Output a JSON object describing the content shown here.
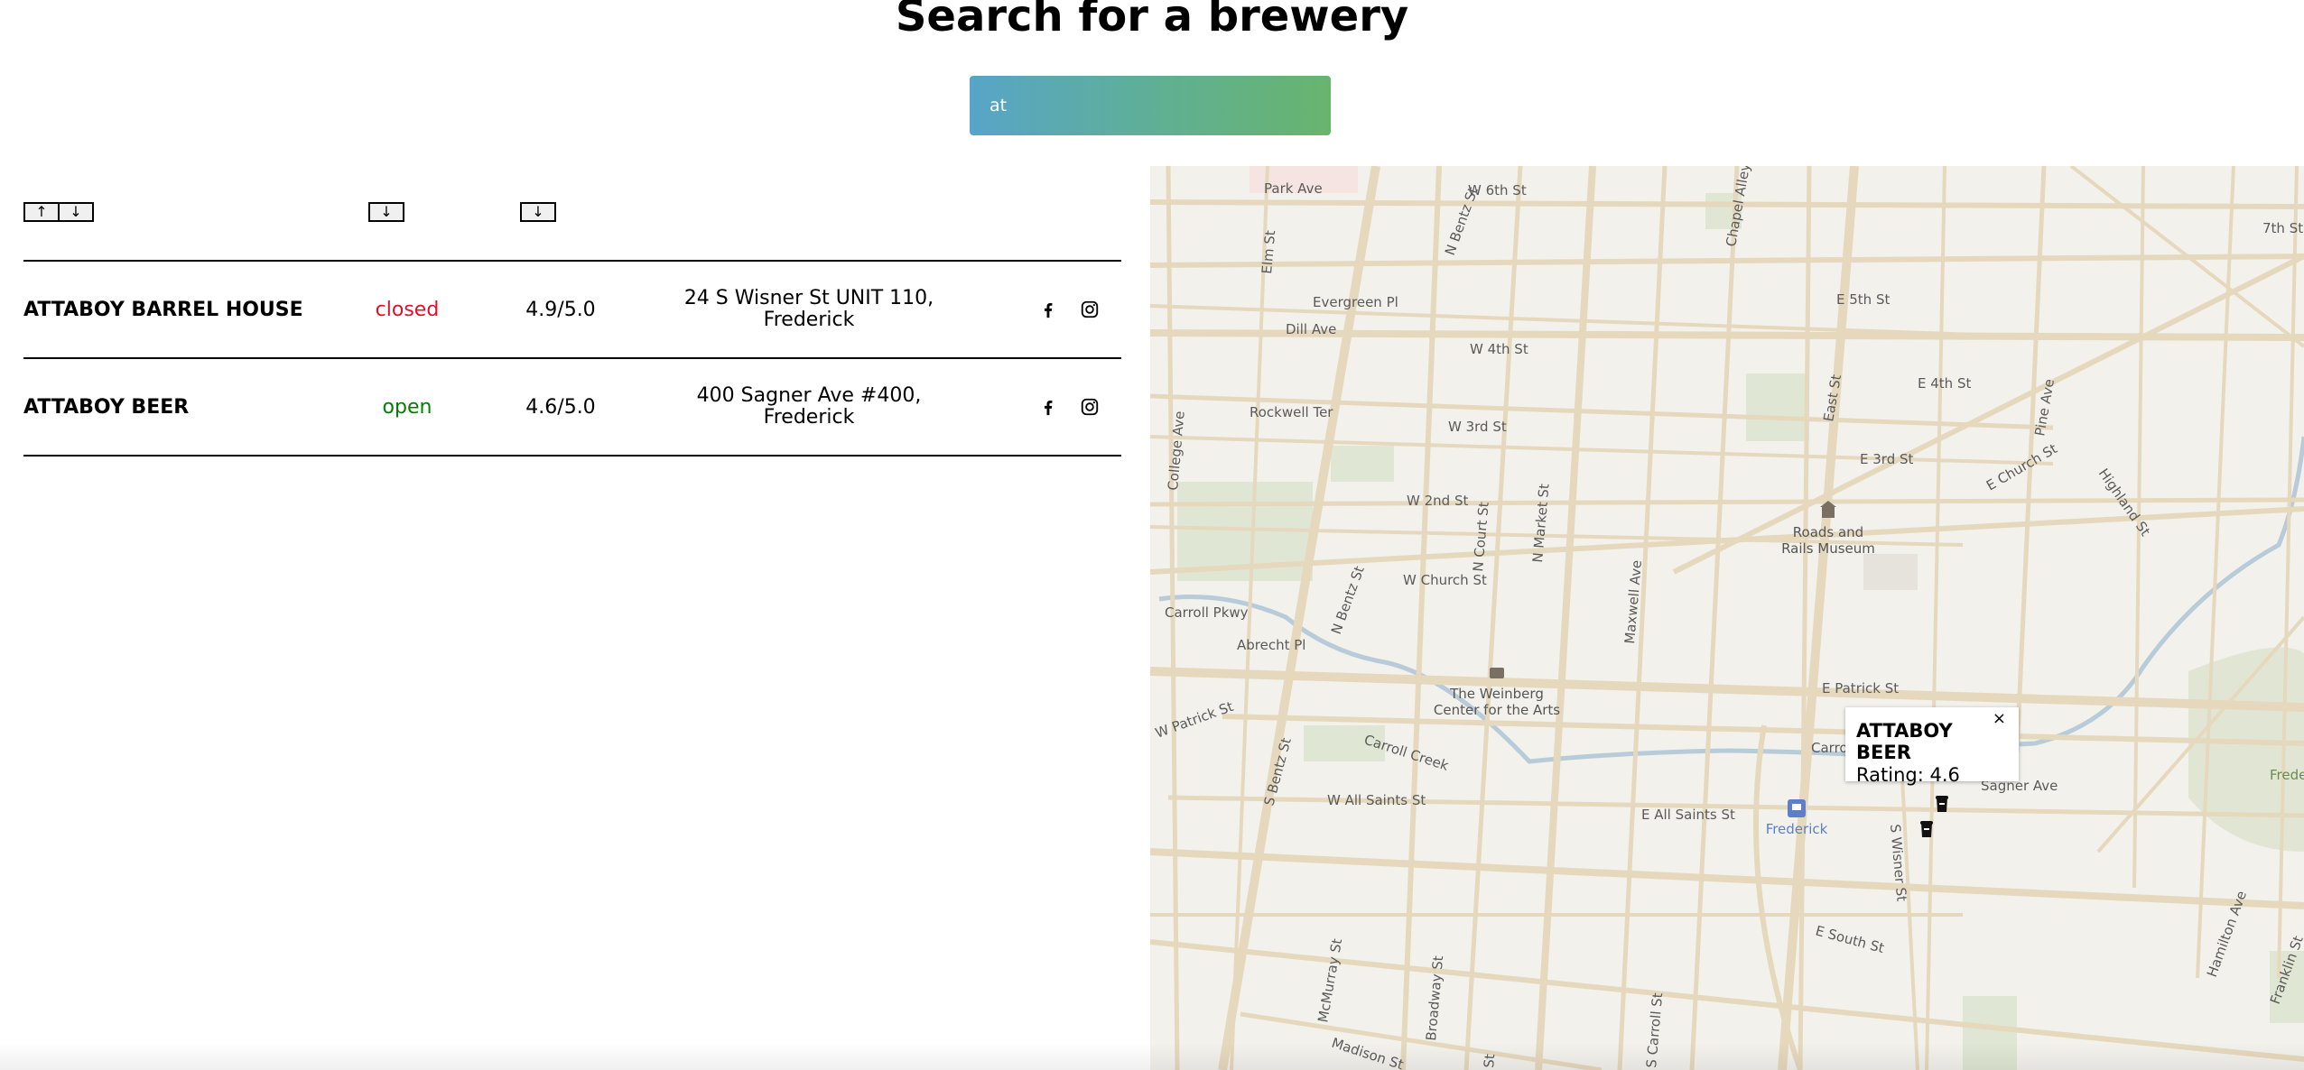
{
  "page": {
    "title": "Search for a brewery"
  },
  "search": {
    "value": "at"
  },
  "sort_controls": {
    "name_asc": "↑",
    "name_desc": "↓",
    "status_desc": "↓",
    "rating_desc": "↓"
  },
  "breweries": [
    {
      "name": "ATTABOY BARREL HOUSE",
      "status": "closed",
      "rating": "4.9/5.0",
      "address_line1": "24 S Wisner St UNIT 110,",
      "address_line2": "Frederick",
      "social": [
        "facebook-icon",
        "instagram-icon"
      ]
    },
    {
      "name": "ATTABOY BEER",
      "status": "open",
      "rating": "4.6/5.0",
      "address_line1": "400 Sagner Ave #400,",
      "address_line2": "Frederick",
      "social": [
        "facebook-icon",
        "instagram-icon"
      ]
    }
  ],
  "colors": {
    "closed": "#e0102a",
    "open": "#008000",
    "search_gradient_start": "#57a5c8",
    "search_gradient_end": "#68b46e"
  },
  "map": {
    "street_labels": {
      "park_ave": "Park Ave",
      "w_6th": "W 6th St",
      "chapel_alley": "Chapel Alley",
      "seventh": "7th St",
      "n_bentz_top": "N Bentz St",
      "elm": "Elm St",
      "evergreen": "Evergreen Pl",
      "e_5th": "E 5th St",
      "dill": "Dill Ave",
      "w_4th": "W 4th St",
      "e_4th": "E 4th St",
      "pine": "Pine Ave",
      "rockwell": "Rockwell Ter",
      "w_3rd": "W 3rd St",
      "east_st": "East St",
      "e_3rd": "E 3rd St",
      "e_church": "E Church St",
      "college": "College Ave",
      "w_2nd": "W 2nd St",
      "n_court": "N Court St",
      "n_market": "N Market St",
      "highland": "Highland St",
      "w_church": "W Church St",
      "maxwell": "Maxwell Ave",
      "carroll_pkwy": "Carroll Pkwy",
      "n_bentz": "N Bentz St",
      "abrecht": "Abrecht Pl",
      "e_patrick": "E Patrick St",
      "w_patrick": "W Patrick St",
      "carroll_creek": "Carroll Creek",
      "carroll_creek_short": "Carro",
      "s_bentz": "S Bentz St",
      "sagner": "Sagner Ave",
      "w_all_saints": "W All Saints St",
      "e_all_saints": "E All Saints St",
      "s_wisner": "S Wisner St",
      "e_south": "E South St",
      "mcmurray": "McMurray St",
      "broadway": "Broadway St",
      "hamilton": "Hamilton Ave",
      "franklin": "Franklin St",
      "madison": "Madison St",
      "s_carroll": "S Carroll St",
      "st_short": "St"
    },
    "pois": {
      "museum_line1": "Roads and",
      "museum_line2": "Rails Museum",
      "weinberg_line1": "The Weinberg",
      "weinberg_line2": "Center for the Arts",
      "station": "Frederick",
      "park_east": "Frederick"
    },
    "popup": {
      "title": "ATTABOY BEER",
      "rating": "Rating: 4.6",
      "close": "×"
    }
  }
}
